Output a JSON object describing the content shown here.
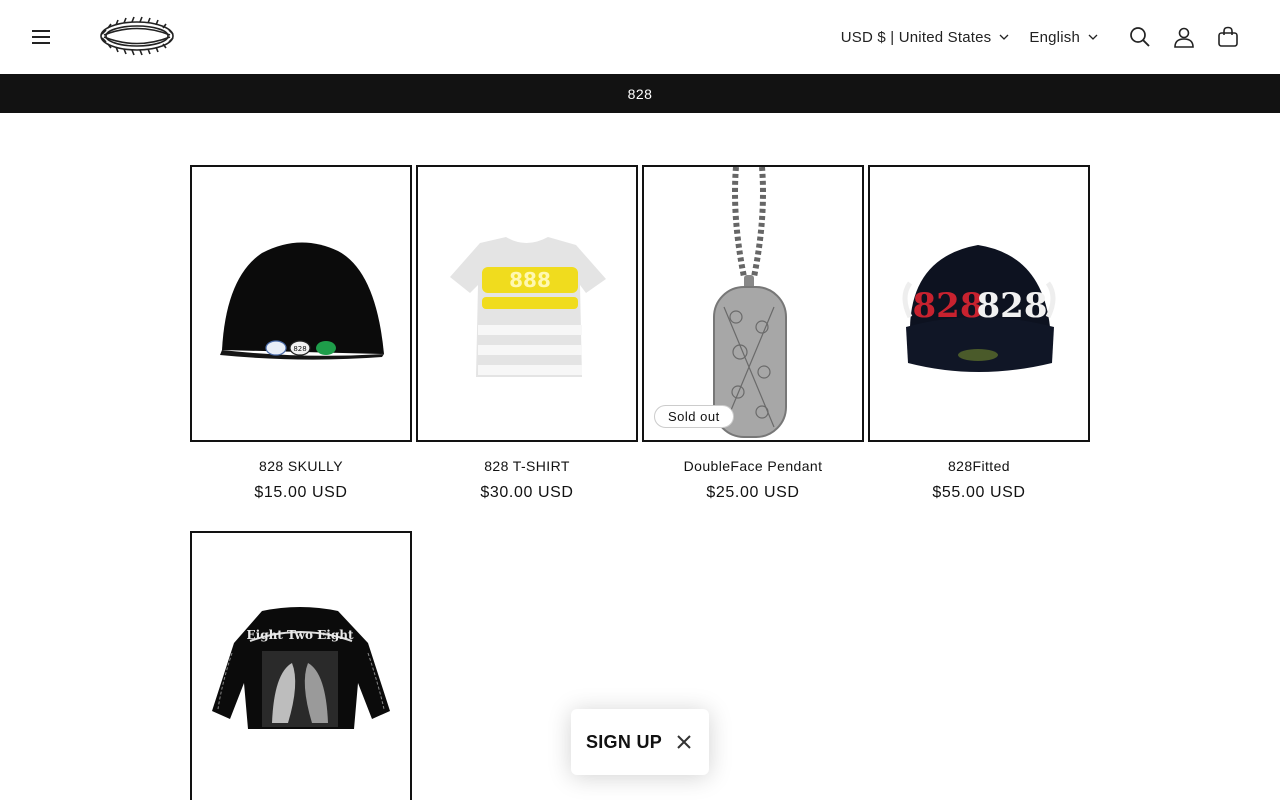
{
  "header": {
    "menu_icon": "hamburger-menu-icon",
    "logo_icon": "barbed-wire-wreath-logo",
    "currency_selector": "USD $ | United States",
    "language_selector": "English",
    "icons": [
      "search-icon",
      "account-icon",
      "cart-icon"
    ]
  },
  "announcement": {
    "text": "828"
  },
  "products": [
    {
      "title": "828 SKULLY",
      "price": "$15.00 USD",
      "image": "black-beanie-with-patches"
    },
    {
      "title": "828 T-SHIRT",
      "price": "$30.00 USD",
      "image": "grey-tshirt-yellow-828-print"
    },
    {
      "title": "DoubleFace Pendant",
      "price": "$25.00 USD",
      "image": "silver-dog-tag-pendant-chain",
      "badge": "Sold out"
    },
    {
      "title": "828Fitted",
      "price": "$55.00 USD",
      "image": "black-fitted-cap-828-embroidery"
    },
    {
      "title": "",
      "price": "",
      "image": "black-longsleeve-eight-two-eight-horses"
    }
  ],
  "signup_popup": {
    "label": "SIGN UP",
    "close_icon": "close-icon"
  },
  "colors": {
    "announcement_bg": "#121212",
    "text": "#121212",
    "background": "#ffffff"
  }
}
